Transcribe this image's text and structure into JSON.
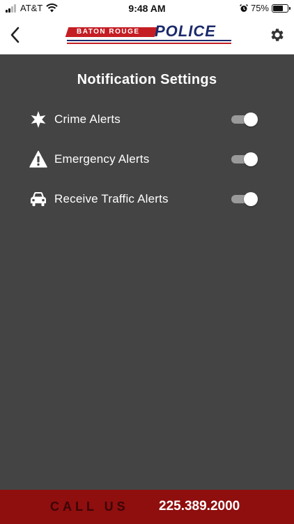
{
  "status_bar": {
    "carrier": "AT&T",
    "time": "9:48 AM",
    "battery_percent": "75%",
    "battery_level": 0.75
  },
  "header": {
    "logo_top": "BATON ROUGE",
    "logo_main": "POLICE"
  },
  "page": {
    "title": "Notification Settings"
  },
  "settings": [
    {
      "label": "Crime Alerts",
      "icon": "star-badge-icon",
      "enabled": true
    },
    {
      "label": "Emergency Alerts",
      "icon": "warning-icon",
      "enabled": true
    },
    {
      "label": "Receive Traffic Alerts",
      "icon": "car-icon",
      "enabled": true
    }
  ],
  "footer": {
    "call_label": "CALL US",
    "phone": "225.389.2000"
  },
  "colors": {
    "background": "#444444",
    "footer": "#8f0e0e",
    "logo_red": "#c41e24",
    "logo_blue": "#1b2a6b"
  }
}
